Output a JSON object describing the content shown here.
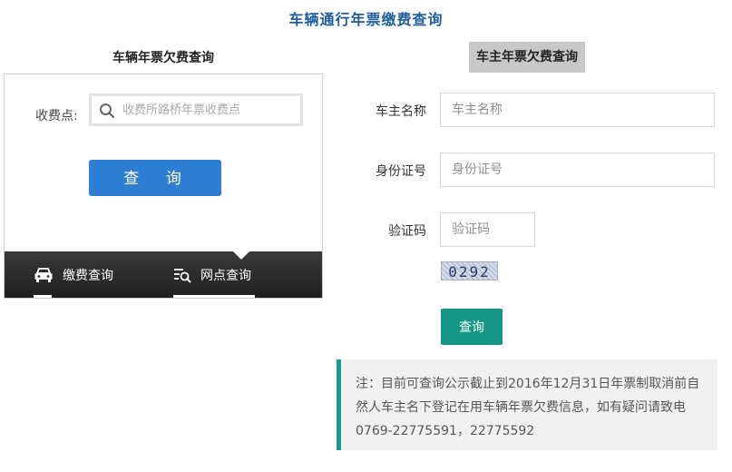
{
  "page": {
    "title": "车辆通行年票缴费查询"
  },
  "left": {
    "heading": "车辆年票欠费查询",
    "station_label": "收费点:",
    "search_placeholder": "收费所路桥年票收费点",
    "query_button": "查 询",
    "bar": {
      "pay_query": "缴费查询",
      "outlet_query": "网点查询"
    }
  },
  "right": {
    "heading": "车主年票欠费查询",
    "owner_label": "车主名称",
    "owner_placeholder": "车主名称",
    "id_label": "身份证号",
    "id_placeholder": "身份证号",
    "captcha_label": "验证码",
    "captcha_placeholder": "验证码",
    "captcha_text": "0292",
    "submit_button": "查询",
    "note": "注：目前可查询公示截止到2016年12月31日年票制取消前自然人车主名下登记在用车辆年票欠费信息，如有疑问请致电0769-22775591，22775592"
  },
  "colors": {
    "title": "#1f5d9c",
    "query_button": "#2e7fd3",
    "submit_button": "#169786",
    "note_border": "#1a9c8c"
  },
  "icons": {
    "search": "search-icon",
    "car": "car-icon",
    "outlet": "list-search-icon"
  }
}
